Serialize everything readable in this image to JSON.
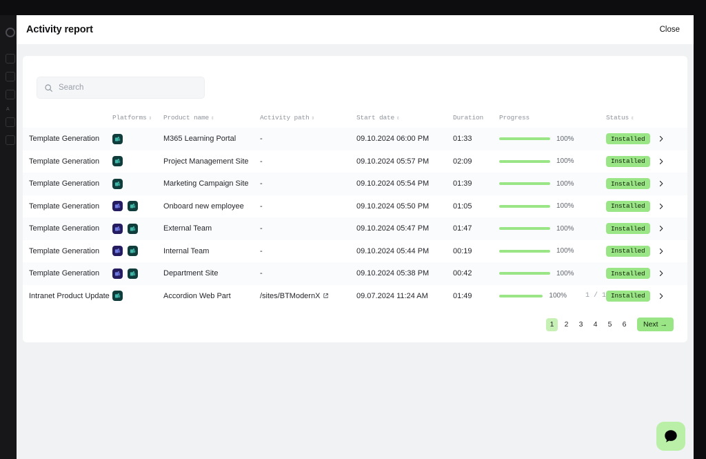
{
  "app": {
    "background_color": "#0d0d0f",
    "rail_labels": [
      "A"
    ]
  },
  "modal": {
    "title": "Activity report",
    "close_label": "Close"
  },
  "search": {
    "placeholder": "Search",
    "value": "",
    "icon": "search-icon"
  },
  "table": {
    "columns": [
      {
        "key": "activity",
        "label": "",
        "sortable": false
      },
      {
        "key": "platforms",
        "label": "Platforms",
        "sortable": true
      },
      {
        "key": "product",
        "label": "Product name",
        "sortable": true
      },
      {
        "key": "path",
        "label": "Activity path",
        "sortable": true
      },
      {
        "key": "start",
        "label": "Start date",
        "sortable": true
      },
      {
        "key": "duration",
        "label": "Duration",
        "sortable": false
      },
      {
        "key": "progress",
        "label": "Progress",
        "sortable": false
      },
      {
        "key": "status",
        "label": "Status",
        "sortable": true
      },
      {
        "key": "chevron",
        "label": "",
        "sortable": false
      }
    ],
    "sort_glyph": "⇕",
    "rows": [
      {
        "activity": "Template Generation",
        "platforms": [
          "sharepoint"
        ],
        "product": "M365 Learning Portal",
        "path": "-",
        "path_is_link": false,
        "start": "09.10.2024 06:00 PM",
        "duration": "01:33",
        "progress_pct": 100,
        "progress_label": "100%",
        "fraction": "",
        "status": "Installed"
      },
      {
        "activity": "Template Generation",
        "platforms": [
          "sharepoint"
        ],
        "product": "Project Management Site",
        "path": "-",
        "path_is_link": false,
        "start": "09.10.2024 05:57 PM",
        "duration": "02:09",
        "progress_pct": 100,
        "progress_label": "100%",
        "fraction": "",
        "status": "Installed"
      },
      {
        "activity": "Template Generation",
        "platforms": [
          "sharepoint"
        ],
        "product": "Marketing Campaign Site",
        "path": "-",
        "path_is_link": false,
        "start": "09.10.2024 05:54 PM",
        "duration": "01:39",
        "progress_pct": 100,
        "progress_label": "100%",
        "fraction": "",
        "status": "Installed"
      },
      {
        "activity": "Template Generation",
        "platforms": [
          "teams",
          "sharepoint"
        ],
        "product": "Onboard new employee",
        "path": "-",
        "path_is_link": false,
        "start": "09.10.2024 05:50 PM",
        "duration": "01:05",
        "progress_pct": 100,
        "progress_label": "100%",
        "fraction": "",
        "status": "Installed"
      },
      {
        "activity": "Template Generation",
        "platforms": [
          "teams",
          "sharepoint"
        ],
        "product": "External Team",
        "path": "-",
        "path_is_link": false,
        "start": "09.10.2024 05:47 PM",
        "duration": "01:47",
        "progress_pct": 100,
        "progress_label": "100%",
        "fraction": "",
        "status": "Installed"
      },
      {
        "activity": "Template Generation",
        "platforms": [
          "teams",
          "sharepoint"
        ],
        "product": "Internal Team",
        "path": "-",
        "path_is_link": false,
        "start": "09.10.2024 05:44 PM",
        "duration": "00:19",
        "progress_pct": 100,
        "progress_label": "100%",
        "fraction": "",
        "status": "Installed"
      },
      {
        "activity": "Template Generation",
        "platforms": [
          "teams",
          "sharepoint"
        ],
        "product": "Department Site",
        "path": "-",
        "path_is_link": false,
        "start": "09.10.2024 05:38 PM",
        "duration": "00:42",
        "progress_pct": 100,
        "progress_label": "100%",
        "fraction": "",
        "status": "Installed"
      },
      {
        "activity": "Intranet Product Update",
        "platforms": [
          "sharepoint"
        ],
        "product": "Accordion Web Part",
        "path": "/sites/BTModernX",
        "path_is_link": true,
        "start": "09.07.2024 11:24 AM",
        "duration": "01:49",
        "progress_pct": 100,
        "progress_label": "100%",
        "fraction": "1 / 1",
        "status": "Installed"
      }
    ]
  },
  "pagination": {
    "pages": [
      "1",
      "2",
      "3",
      "4",
      "5",
      "6"
    ],
    "active_page": "1",
    "next_label": "Next →"
  },
  "chat": {
    "icon": "chat-bubble-icon",
    "background_color": "#b9efa6"
  },
  "colors": {
    "accent_green": "#9ae585",
    "active_page_green": "#c6f0b4",
    "sharepoint": "#103c3c",
    "teams": "#241c5e",
    "row_odd": "#fafbfc",
    "page_bg": "#f1f2f4"
  }
}
